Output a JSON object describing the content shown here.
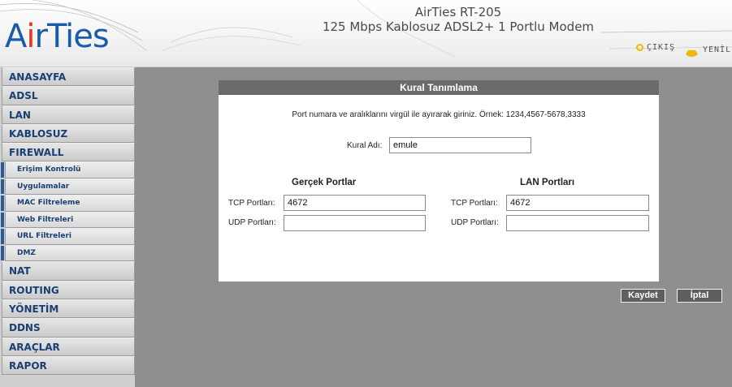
{
  "header": {
    "logo": {
      "part1": "A",
      "part2": "i",
      "part3": "r",
      "part4": "Ties"
    },
    "title_line1": "AirTies RT-205",
    "title_line2": "125 Mbps Kablosuz ADSL2+ 1 Portlu Modem",
    "links": [
      {
        "label": "ÇIKIŞ",
        "icon": "power-icon"
      },
      {
        "label": "YENİLE",
        "icon": "home-icon"
      }
    ]
  },
  "sidebar": {
    "items": [
      {
        "label": "ANASAYFA",
        "type": "main"
      },
      {
        "label": "ADSL",
        "type": "main"
      },
      {
        "label": "LAN",
        "type": "main"
      },
      {
        "label": "KABLOSUZ",
        "type": "main"
      },
      {
        "label": "FIREWALL",
        "type": "main"
      },
      {
        "label": "Erişim Kontrolü",
        "type": "sub"
      },
      {
        "label": "Uygulamalar",
        "type": "sub"
      },
      {
        "label": "MAC Filtreleme",
        "type": "sub"
      },
      {
        "label": "Web Filtreleri",
        "type": "sub"
      },
      {
        "label": "URL Filtreleri",
        "type": "sub"
      },
      {
        "label": "DMZ",
        "type": "sub"
      },
      {
        "label": "NAT",
        "type": "main"
      },
      {
        "label": "ROUTING",
        "type": "main"
      },
      {
        "label": "YÖNETİM",
        "type": "main"
      },
      {
        "label": "DDNS",
        "type": "main"
      },
      {
        "label": "ARAÇLAR",
        "type": "main"
      },
      {
        "label": "RAPOR",
        "type": "main"
      }
    ]
  },
  "panel": {
    "title": "Kural Tanımlama",
    "hint": "Port numara ve aralıklarını virgül ile ayırarak giriniz. Örnek: 1234,4567-5678,3333",
    "rule_name_label": "Kural Adı:",
    "rule_name_value": "emule",
    "real_ports": {
      "heading": "Gerçek Portlar",
      "tcp_label": "TCP Portları:",
      "tcp_value": "4672",
      "udp_label": "UDP Portları:",
      "udp_value": ""
    },
    "lan_ports": {
      "heading": "LAN Portları",
      "tcp_label": "TCP Portları:",
      "tcp_value": "4672",
      "udp_label": "UDP Portları:",
      "udp_value": ""
    }
  },
  "buttons": {
    "save": "Kaydet",
    "cancel": "İptal"
  },
  "colors": {
    "background": "#8f8f8f",
    "panel_header": "#6b6b6b",
    "nav_text": "#1a3f72",
    "logo_blue": "#1b5ca7",
    "logo_red": "#e23b1b"
  }
}
